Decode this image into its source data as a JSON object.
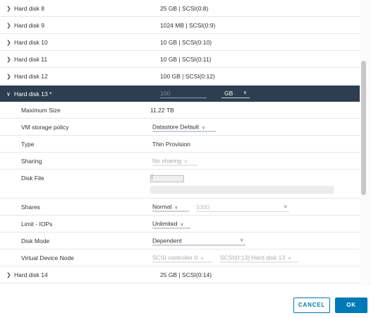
{
  "disks_above": [
    {
      "label": "Hard disk 8",
      "value": "25 GB | SCSI(0:8)"
    },
    {
      "label": "Hard disk 9",
      "value": "1024 MB | SCSI(0:9)"
    },
    {
      "label": "Hard disk 10",
      "value": "10 GB | SCSI(0:10)"
    },
    {
      "label": "Hard disk 11",
      "value": "10 GB | SCSI(0:11)"
    },
    {
      "label": "Hard disk 12",
      "value": "100 GB | SCSI(0:12)"
    }
  ],
  "expanded": {
    "label": "Hard disk 13 *",
    "size_value": "100",
    "size_unit": "GB",
    "props": {
      "max_size_label": "Maximum Size",
      "max_size_value": "11.22 TB",
      "policy_label": "VM storage policy",
      "policy_value": "Datastore Default",
      "type_label": "Type",
      "type_value": "Thin Provision",
      "sharing_label": "Sharing",
      "sharing_value": "No sharing",
      "disk_file_label": "Disk File",
      "disk_file_value": "[",
      "shares_label": "Shares",
      "shares_value": "Normal",
      "shares_amount": "1000",
      "limit_label": "Limit - IOPs",
      "limit_value": "Unlimited",
      "mode_label": "Disk Mode",
      "mode_value": "Dependent",
      "vdn_label": "Virtual Device Node",
      "vdn_controller": "SCSI controller 0",
      "vdn_node": "SCSI(0:13) Hard disk 13"
    }
  },
  "disks_below": [
    {
      "label": "Hard disk 14",
      "value": "25 GB | SCSI(0:14)"
    }
  ],
  "buttons": {
    "cancel": "CANCEL",
    "ok": "OK"
  },
  "icons": {
    "collapsed": "chevron-right-icon",
    "expanded": "chevron-down-icon"
  },
  "colors": {
    "header_bg": "#2d3e50",
    "primary": "#0079b8"
  }
}
